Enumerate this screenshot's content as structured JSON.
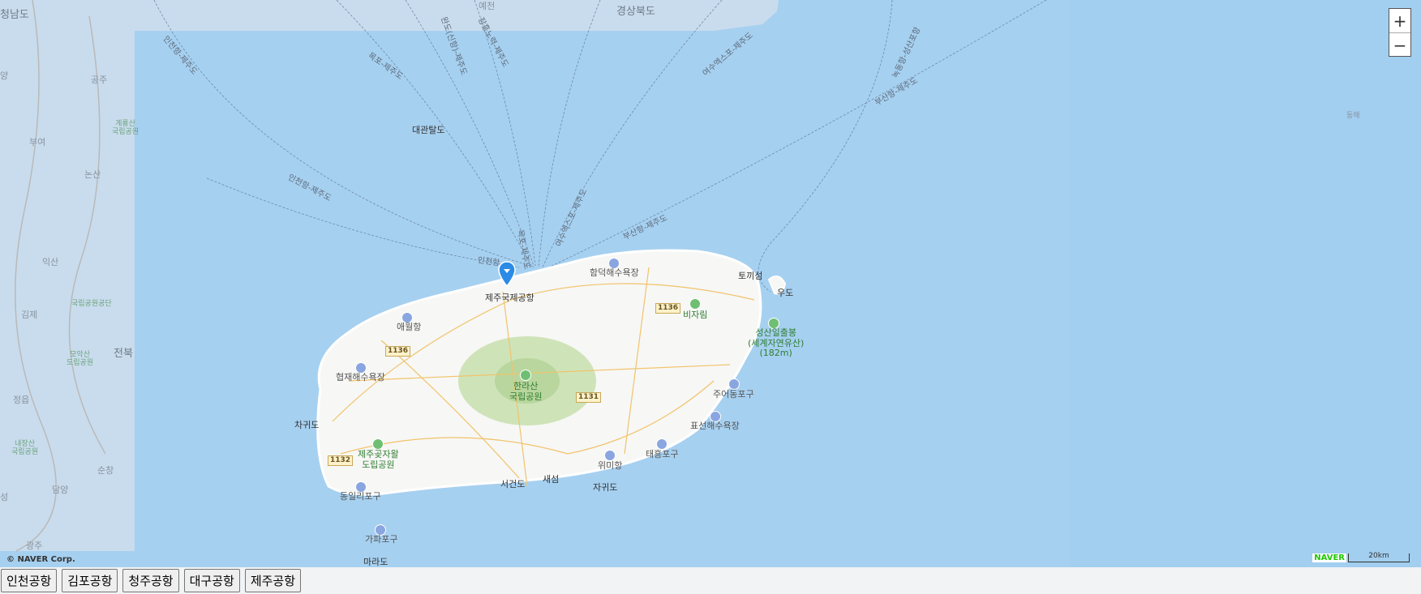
{
  "map": {
    "land_labels": [
      "청남도",
      "경상북도",
      "예천",
      "공주",
      "부여",
      "논산",
      "익산",
      "김제",
      "정읍",
      "순창",
      "담양",
      "광주",
      "전북",
      "양",
      "성",
      "대관탈도",
      "동해",
      "계룡산\n국립공원",
      "국립공원공단",
      "모악산\n도립공원",
      "내장산\n국립공원"
    ],
    "jeju_labels": {
      "airport": "제주국제공항",
      "aewol": "애월항",
      "hyeopjae": "협재해수욕장",
      "chagwido": "차귀도",
      "hamdeok": "함덕해수욕장",
      "toggiseom": "토끼섬",
      "udo": "우도",
      "bijarim": "비자림",
      "seongsan": "성산일출봉\n(세계자연유산)\n(182m)",
      "hallasan": "한라산\n국립공원",
      "jueodong": "주어동포구",
      "pyoseon": "표선해수욕장",
      "taeheung": "태흥포구",
      "wimi": "위미항",
      "jagwido": "자귀도",
      "saeseom": "새섬",
      "seogeondo": "서건도",
      "jejugotjawal": "제주곶자왈\n도립공원",
      "dongilri": "동일리포구",
      "gapa": "가파포구",
      "marado": "마라도",
      "incheon_port": "인천항"
    },
    "ferry_routes": [
      "인천항-제주도",
      "목포-제주도",
      "여수엑스포-제주도",
      "부산항-제주도",
      "녹동항-성산포항",
      "인천항-제주도",
      "목포-제주도",
      "여수엑스포-제주도",
      "부산항-제주도",
      "목포-제주도",
      "인천항-제주도",
      "장흥노력-제주도",
      "완도(신항)-제주도"
    ],
    "road_numbers": [
      "1136",
      "1136",
      "1131",
      "1132"
    ],
    "zoom_in": "+",
    "zoom_out": "−",
    "copyright": "© NAVER Corp.",
    "logo": "NAVER",
    "scale": "20km",
    "colors": {
      "sea": "#a6d0f0",
      "land": "#f7f7f5",
      "park": "#cfe3b8",
      "marker": "#2b8be6"
    }
  },
  "buttons": [
    "인천공항",
    "김포공항",
    "청주공항",
    "대구공항",
    "제주공항"
  ]
}
